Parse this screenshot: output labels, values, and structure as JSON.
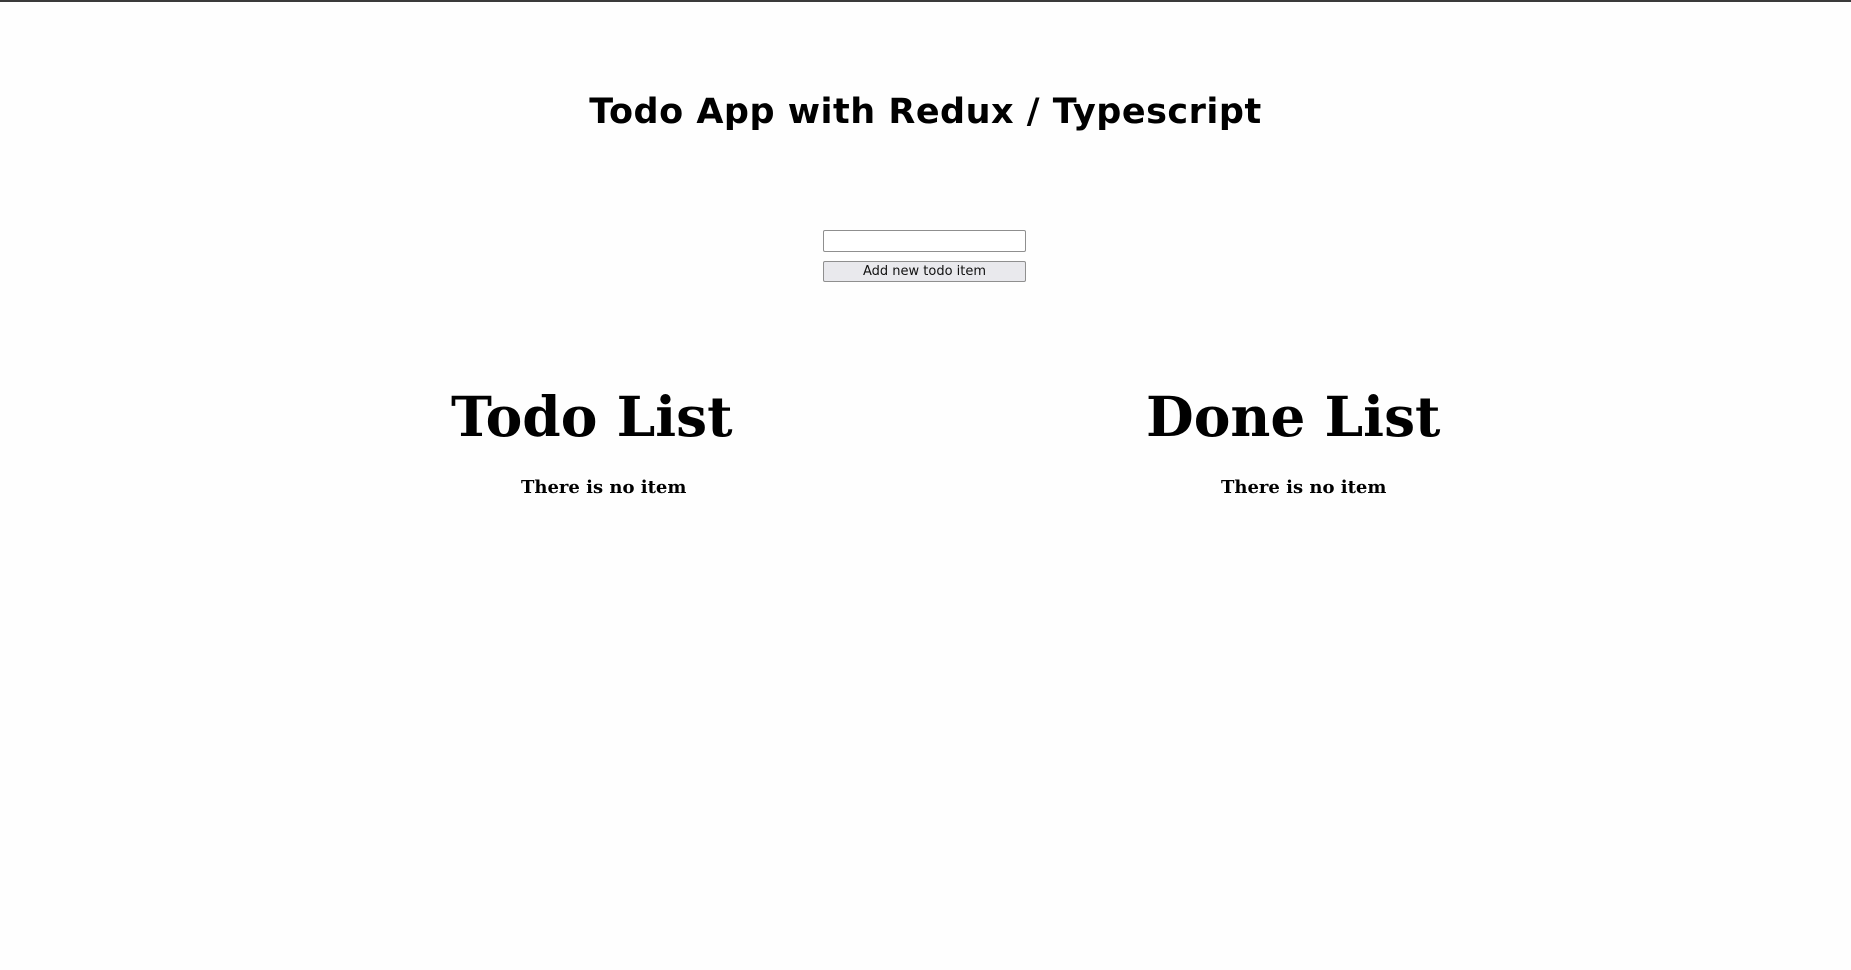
{
  "app": {
    "title": "Todo App with Redux / Typescript"
  },
  "form": {
    "input_value": "",
    "input_placeholder": "",
    "add_button_label": "Add new todo item"
  },
  "lists": {
    "todo": {
      "heading": "Todo List",
      "empty_message": "There is no item"
    },
    "done": {
      "heading": "Done List",
      "empty_message": "There is no item"
    }
  }
}
